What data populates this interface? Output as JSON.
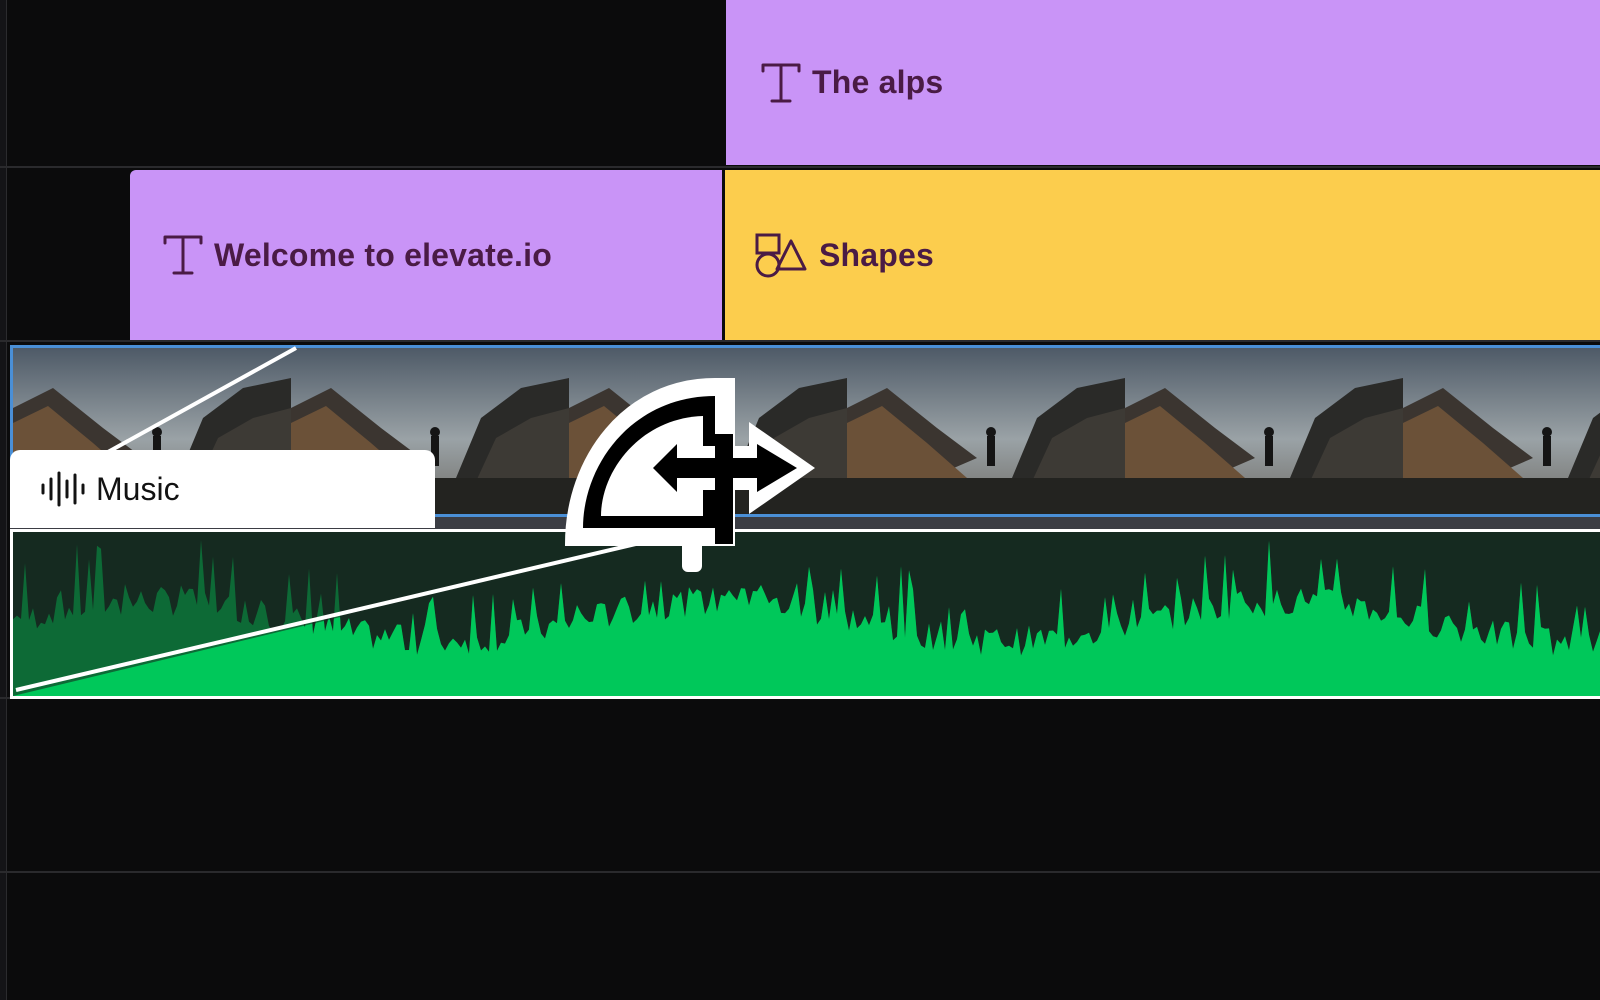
{
  "tracks": {
    "text_top": {
      "label": "The alps",
      "icon": "text-icon",
      "color": "#c994f7"
    },
    "text_second": {
      "label": "Welcome to elevate.io",
      "icon": "text-icon",
      "color": "#c994f7"
    },
    "shapes": {
      "label": "Shapes",
      "icon": "shapes-icon",
      "color": "#fccd4d"
    },
    "video": {
      "icon": "video-thumbnail",
      "border_color": "#4a8fd6"
    },
    "audio": {
      "label": "Music",
      "icon": "waveform-icon",
      "waveform_color": "#00c85a",
      "background": "#152a20"
    }
  },
  "cursor": {
    "icon": "fade-drag-cursor-icon"
  },
  "colors": {
    "background": "#0b0b0c",
    "divider": "#2a2a2d",
    "text_clip_fg": "#4a1b45"
  }
}
